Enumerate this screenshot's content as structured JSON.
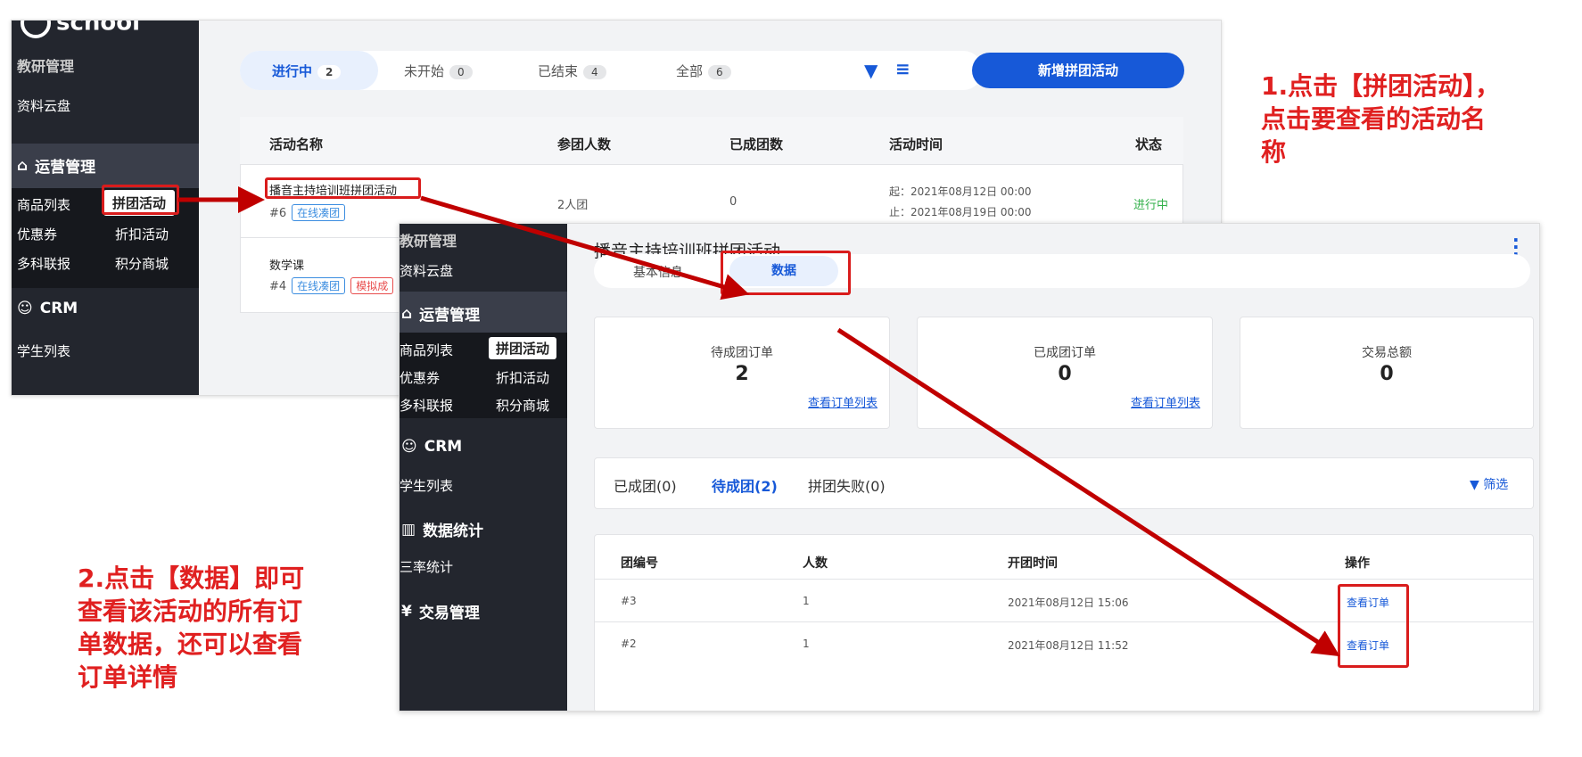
{
  "shot1": {
    "sidebar": {
      "logo_text": "school",
      "item_top": "教研管理",
      "item_cloud": "资料云盘",
      "section_ops": "运营管理",
      "items": [
        [
          "商品列表",
          "拼团活动"
        ],
        [
          "优惠券",
          "折扣活动"
        ],
        [
          "多科联报",
          "积分商城"
        ]
      ],
      "section_crm": "CRM",
      "item_students": "学生列表"
    },
    "tabs": [
      {
        "label": "进行中",
        "count": "2"
      },
      {
        "label": "未开始",
        "count": "0"
      },
      {
        "label": "已结束",
        "count": "4"
      },
      {
        "label": "全部",
        "count": "6"
      }
    ],
    "new_button": "新增拼团活动",
    "table": {
      "headers": [
        "活动名称",
        "参团人数",
        "已成团数",
        "活动时间",
        "状态"
      ],
      "row1": {
        "name": "播音主持培训班拼团活动",
        "id": "#6",
        "tag": "在线凑团",
        "people": "2人团",
        "done": "0",
        "start": "起：2021年08月12日 00:00",
        "end": "止：2021年08月19日 00:00",
        "status": "进行中"
      },
      "row2": {
        "name": "数学课",
        "id": "#4",
        "tag1": "在线凑团",
        "tag2": "模拟成"
      }
    }
  },
  "shot2": {
    "title": "播音主持培训班拼团活动",
    "tab_info": "基本信息",
    "tab_data": "数据",
    "sidebar": {
      "item_top": "教研管理",
      "item_cloud": "资料云盘",
      "section_ops": "运营管理",
      "items": [
        [
          "商品列表",
          "拼团活动"
        ],
        [
          "优惠券",
          "折扣活动"
        ],
        [
          "多科联报",
          "积分商城"
        ]
      ],
      "section_crm": "CRM",
      "item_students": "学生列表",
      "section_stats": "数据统计",
      "item_rate": "三率统计",
      "section_trade": "交易管理"
    },
    "stats": [
      {
        "label": "待成团订单",
        "value": "2",
        "link": "查看订单列表"
      },
      {
        "label": "已成团订单",
        "value": "0",
        "link": "查看订单列表"
      },
      {
        "label": "交易总额",
        "value": "0"
      }
    ],
    "subtabs": [
      "已成团(0)",
      "待成团(2)",
      "拼团失败(0)"
    ],
    "filter": "筛选",
    "table": {
      "headers": [
        "团编号",
        "人数",
        "开团时间",
        "操作"
      ],
      "rows": [
        {
          "id": "#3",
          "people": "1",
          "time": "2021年08月12日 15:06",
          "action": "查看订单"
        },
        {
          "id": "#2",
          "people": "1",
          "time": "2021年08月12日 11:52",
          "action": "查看订单"
        }
      ]
    }
  },
  "annotations": {
    "step1": [
      "1.点击【拼团活动】，",
      "点击要查看的活动名",
      "称"
    ],
    "step2": [
      "2.点击【数据】即可",
      "查看该活动的所有订",
      "单数据，还可以查看",
      "订单详情"
    ]
  },
  "colors": {
    "accent": "#1759d8",
    "annotation": "#e02020",
    "sidebar": "#23262e",
    "status_green": "#32b04a"
  }
}
